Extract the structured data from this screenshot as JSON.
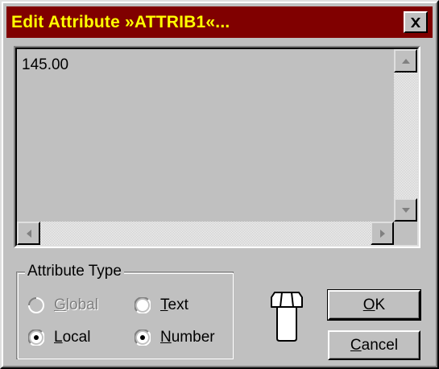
{
  "window": {
    "title": "Edit Attribute »ATTRIB1«...",
    "close_icon": "close-icon"
  },
  "editor": {
    "value": "145.00"
  },
  "attribute_type": {
    "legend": "Attribute Type",
    "options": {
      "global": {
        "label": "Global",
        "underline": "G",
        "rest": "lobal",
        "selected": false,
        "enabled": false
      },
      "text": {
        "label": "Text",
        "underline": "T",
        "rest": "ext",
        "selected": false,
        "enabled": true
      },
      "local": {
        "label": "Local",
        "underline": "L",
        "rest": "ocal",
        "selected": true,
        "enabled": true
      },
      "number": {
        "label": "Number",
        "underline": "N",
        "rest": "umber",
        "selected": true,
        "enabled": true
      }
    }
  },
  "icon": "bolt-icon",
  "buttons": {
    "ok": {
      "underline": "O",
      "rest": "K",
      "label": "OK"
    },
    "cancel": {
      "underline": "C",
      "rest": "ancel",
      "label": "Cancel"
    }
  },
  "colors": {
    "titlebar": "#800000",
    "title_text": "#ffff00",
    "face": "#c0c0c0"
  }
}
